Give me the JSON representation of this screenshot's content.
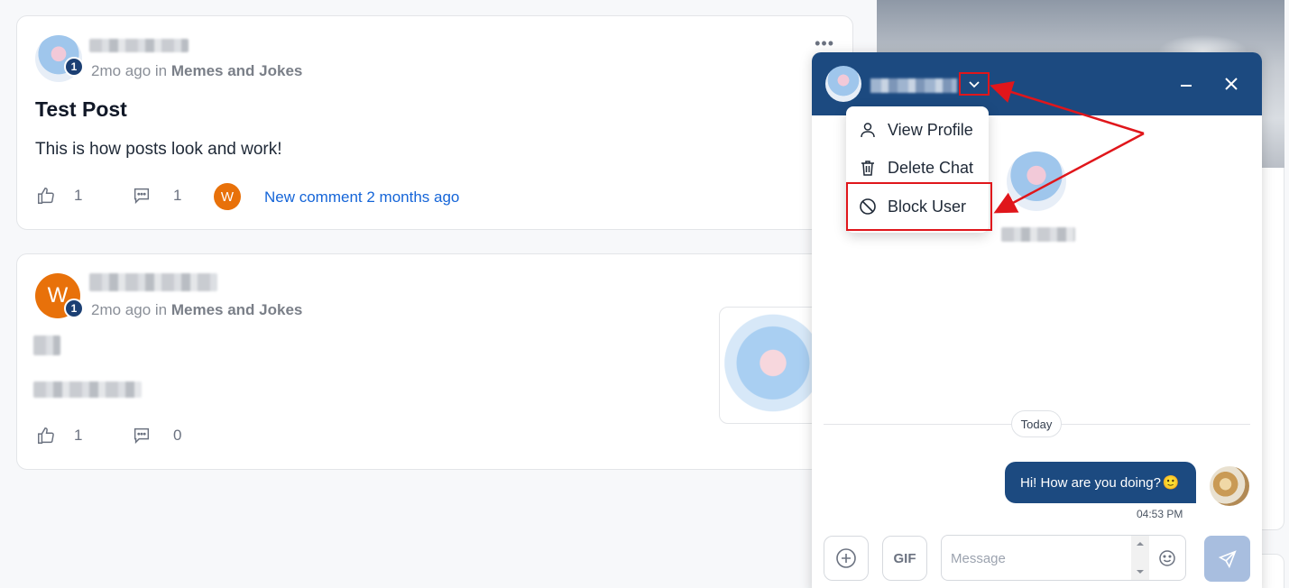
{
  "posts": [
    {
      "time_text": "2mo ago in",
      "community": "Memes and Jokes",
      "level": "1",
      "title": "Test Post",
      "body": "This is how posts look and work!",
      "likes": "1",
      "comments": "1",
      "commenter_initial": "W",
      "new_comment_text": "New comment 2 months ago"
    },
    {
      "time_text": "2mo ago in",
      "community": "Memes and Jokes",
      "level": "1",
      "author_initial": "W",
      "likes": "1",
      "comments": "0"
    }
  ],
  "chat": {
    "menu": {
      "view_profile": "View Profile",
      "delete_chat": "Delete Chat",
      "block_user": "Block User"
    },
    "date_divider": "Today",
    "message": {
      "text": "Hi! How are you doing?",
      "emoji": "🙂",
      "time": "04:53 PM"
    },
    "input": {
      "placeholder": "Message",
      "gif_label": "GIF"
    }
  },
  "colors": {
    "chat_header": "#1c4a80",
    "highlight": "#e0161b",
    "link": "#1565d8",
    "avatar_orange": "#e8710a"
  },
  "icons": [
    "more-icon",
    "like-icon",
    "comment-icon",
    "chevron-down-icon",
    "minimize-icon",
    "close-icon",
    "user-icon",
    "trash-icon",
    "block-icon",
    "plus-icon",
    "emoji-icon",
    "send-icon"
  ]
}
